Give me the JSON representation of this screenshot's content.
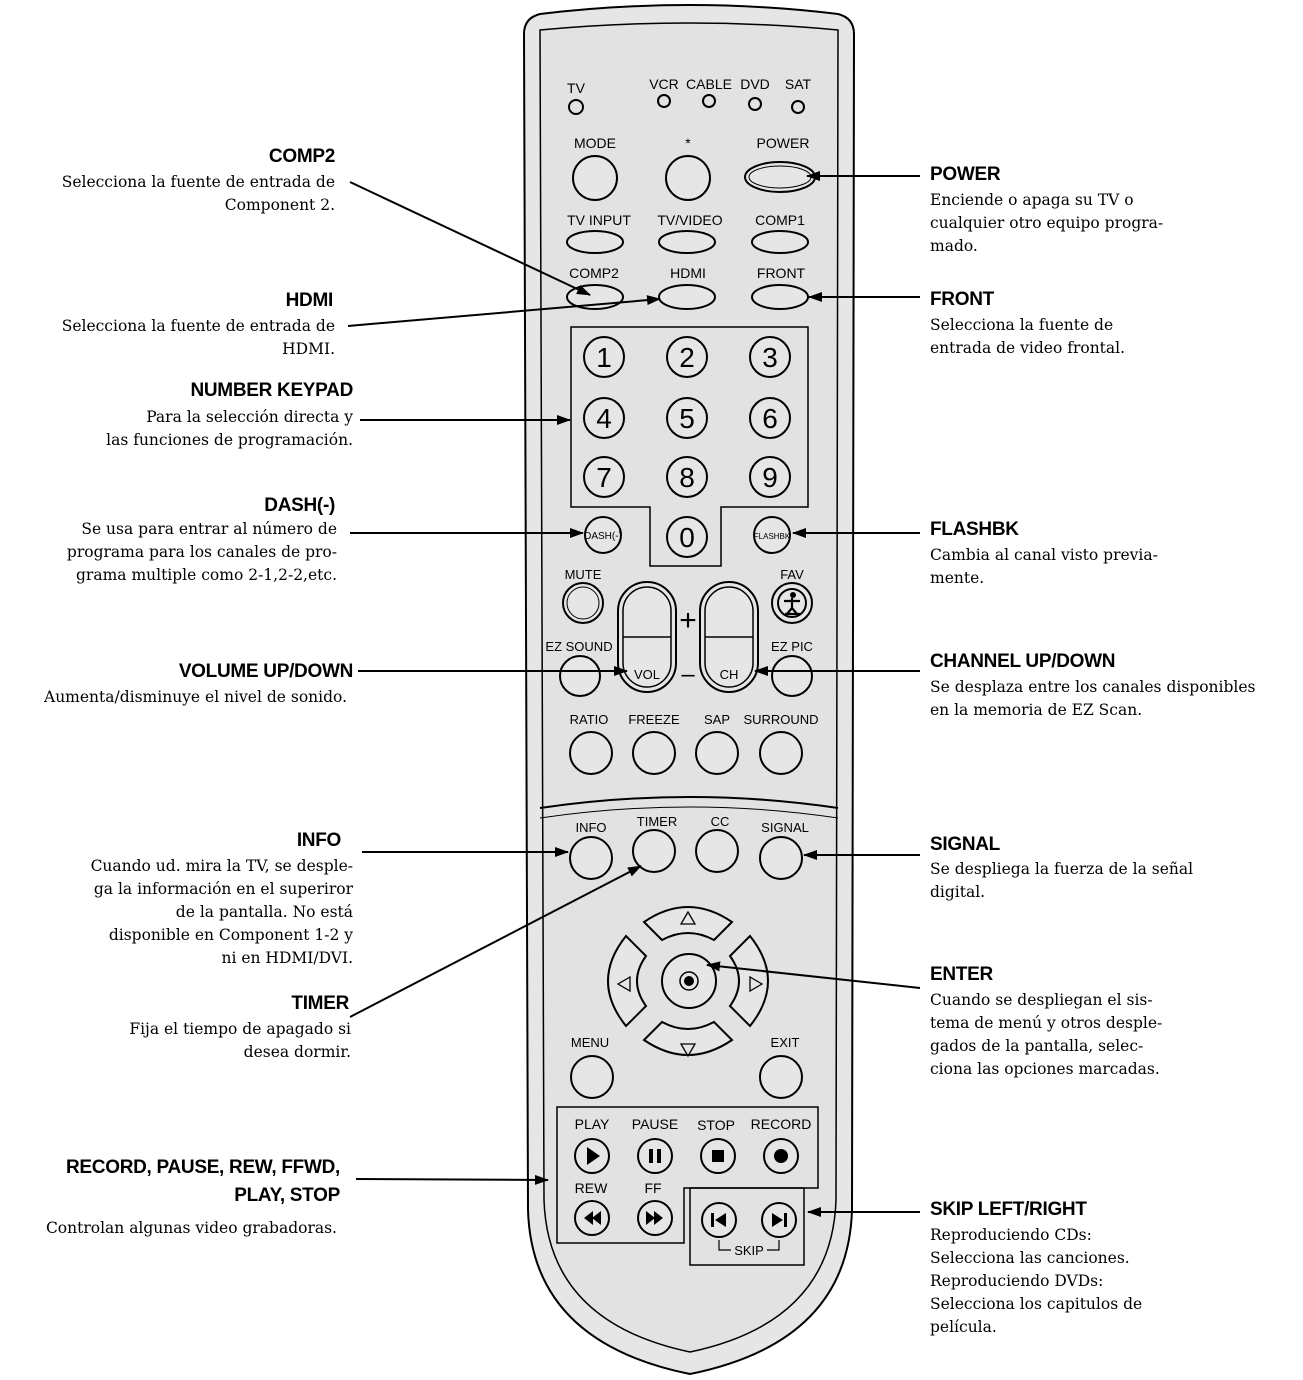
{
  "remote": {
    "modes": [
      "TV",
      "VCR",
      "CABLE",
      "DVD",
      "SAT"
    ],
    "row1": [
      "MODE",
      "*",
      "POWER"
    ],
    "row2": [
      "TV INPUT",
      "TV/VIDEO",
      "COMP1"
    ],
    "row3": [
      "COMP2",
      "HDMI",
      "FRONT"
    ],
    "digits": [
      "1",
      "2",
      "3",
      "4",
      "5",
      "6",
      "7",
      "8",
      "9",
      "0"
    ],
    "dash": "DASH(-)",
    "flashbk": "FLASHBK",
    "mute": "MUTE",
    "fav": "FAV",
    "plus": "+",
    "minus": "–",
    "vol": "VOL",
    "ch": "CH",
    "ez_sound": "EZ SOUND",
    "ez_pic": "EZ PIC",
    "row_ratio": [
      "RATIO",
      "FREEZE",
      "SAP",
      "SURROUND"
    ],
    "row_info": [
      "INFO",
      "TIMER",
      "CC",
      "SIGNAL"
    ],
    "menu": "MENU",
    "exit": "EXIT",
    "transport": [
      "PLAY",
      "PAUSE",
      "STOP",
      "RECORD"
    ],
    "rew": "REW",
    "ff": "FF",
    "skip": "SKIP"
  },
  "callouts": {
    "comp2": {
      "title": "COMP2",
      "desc": "Selecciona la fuente de entrada de\nComponent 2."
    },
    "hdmi": {
      "title": "HDMI",
      "desc": "Selecciona la fuente de entrada de\nHDMI."
    },
    "number_keypad": {
      "title": "NUMBER KEYPAD",
      "desc": "Para la selección directa y\nlas funciones de programación."
    },
    "dash": {
      "title": "DASH(-)",
      "desc": "Se usa para entrar  al número de\nprograma para los canales de pro-\ngrama multiple como 2-1,2-2,etc."
    },
    "volume": {
      "title": "VOLUME UP/DOWN",
      "desc": "Aumenta/disminuye el nivel de sonido."
    },
    "info": {
      "title": "INFO",
      "desc": "Cuando ud. mira la TV, se desple-\nga la información en el superiror\nde la pantalla. No está\ndisponible en Component 1-2 y\nni en HDMI/DVI."
    },
    "timer": {
      "title": "TIMER",
      "desc": "Fija el tiempo de apagado si\ndesea dormir."
    },
    "record": {
      "title": "RECORD, PAUSE, REW, FFWD,\nPLAY, STOP",
      "desc": "Controlan algunas video grabadoras."
    },
    "power": {
      "title": "POWER",
      "desc": "Enciende o apaga su TV o\ncualquier otro equipo progra-\nmado."
    },
    "front": {
      "title": "FRONT",
      "desc": "Selecciona la fuente de\nentrada de video frontal."
    },
    "flashbk": {
      "title": "FLASHBK",
      "desc": "Cambia al canal visto previa-\nmente."
    },
    "channel": {
      "title": "CHANNEL UP/DOWN",
      "desc": "Se desplaza entre los canales disponibles\nen la memoria de EZ Scan."
    },
    "signal": {
      "title": "SIGNAL",
      "desc": "Se despliega la fuerza de la señal\ndigital."
    },
    "enter": {
      "title": "ENTER",
      "desc": "Cuando se despliegan el sis-\ntema de menú y otros desple-\ngados de la pantalla, selec-\nciona las opciones marcadas."
    },
    "skip": {
      "title": "SKIP LEFT/RIGHT",
      "desc": "Reproduciendo CDs:\nSelecciona las canciones.\nReproduciendo DVDs:\nSelecciona los capitulos de\npelícula."
    }
  }
}
